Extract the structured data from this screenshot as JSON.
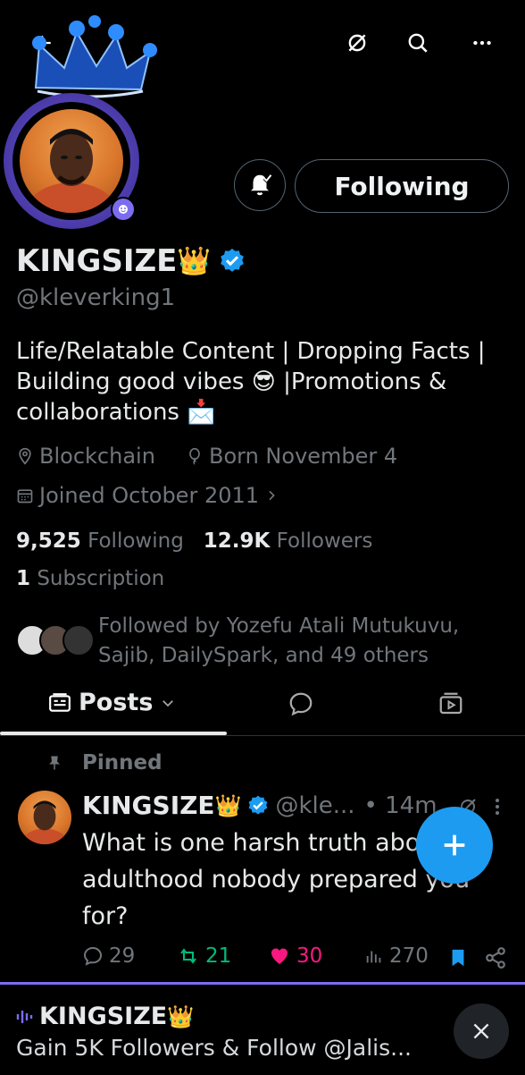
{
  "header": {
    "back_icon": "arrow-left-icon",
    "actions": [
      "spaces-icon",
      "search-icon",
      "more-icon"
    ]
  },
  "profile": {
    "name": "KINGSIZE",
    "name_emoji": "👑",
    "verified": true,
    "handle": "@kleverking1",
    "bio": "Life/Relatable Content | Dropping Facts | Building good vibes 😎 |Promotions & collaborations 📩",
    "location": "Blockchain",
    "birthday": "Born November 4",
    "joined": "Joined October 2011",
    "following_count": "9,525",
    "following_label": "Following",
    "followers_count": "12.9K",
    "followers_label": "Followers",
    "subscription_count": "1",
    "subscription_label": "Subscription",
    "followed_by": "Followed by Yozefu Atali Mutukuvu, Sajib, DailySpark, and 49 others",
    "follow_button": "Following"
  },
  "tabs": {
    "posts_label": "Posts"
  },
  "pinned_post": {
    "pinned_label": "Pinned",
    "author": "KINGSIZE",
    "author_emoji": "👑",
    "handle": "@kle...",
    "time": "• 14m",
    "text": "What is one harsh truth about adulthood nobody prepared you for?",
    "replies": "29",
    "reposts": "21",
    "likes": "30",
    "views": "270"
  },
  "colors": {
    "accent": "#1d9bf0",
    "repost": "#00ba7c",
    "like": "#f91880",
    "space_purple": "#7b6cf0"
  },
  "space_bar": {
    "host": "KINGSIZE",
    "host_emoji": "👑",
    "title": "Gain 5K Followers & Follow @Jalis..."
  }
}
